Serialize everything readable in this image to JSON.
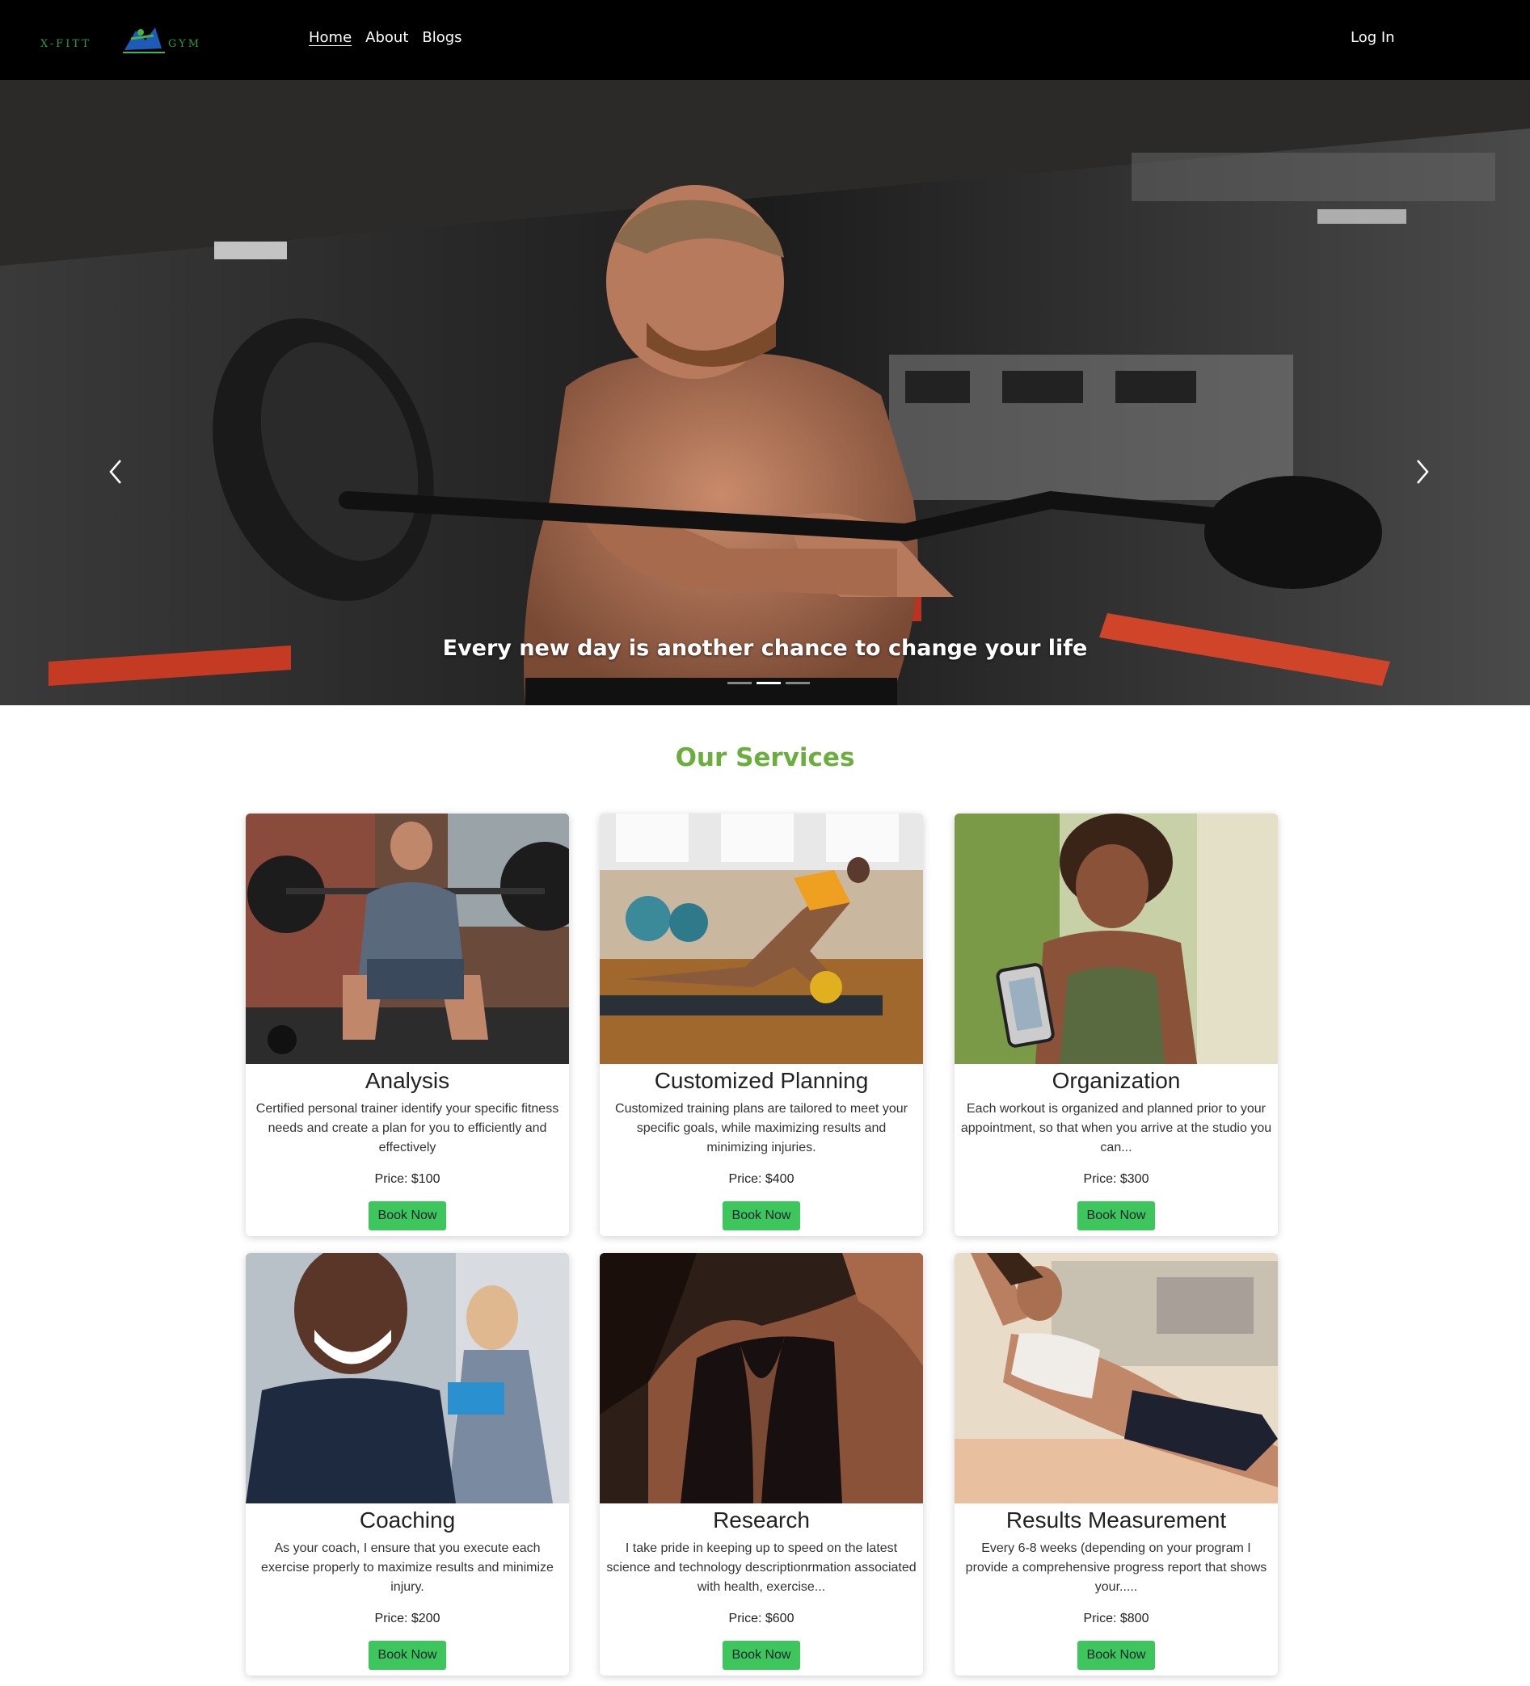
{
  "nav": {
    "logo_text_left": "X-FITT",
    "logo_text_right": "GYM",
    "links": [
      "Home",
      "About",
      "Blogs"
    ],
    "login": "Log In"
  },
  "hero": {
    "caption": "Every new day is another chance to change your life",
    "slides_count": 3,
    "active_slide": 2
  },
  "services": {
    "title": "Our Services",
    "book_label": "Book Now",
    "cards": [
      {
        "title": "Analysis",
        "desc": "Certified personal trainer identify your specific fitness needs and create a plan for you to efficiently and effectively",
        "price": "Price: $100"
      },
      {
        "title": "Customized Planning",
        "desc": "Customized training plans are tailored to meet your specific goals, while maximizing results and minimizing injuries.",
        "price": "Price: $400"
      },
      {
        "title": "Organization",
        "desc": "Each workout is organized and planned prior to your appointment, so that when you arrive at the studio you can...",
        "price": "Price: $300"
      },
      {
        "title": "Coaching",
        "desc": "As your coach, I ensure that you execute each exercise properly to maximize results and minimize injury.",
        "price": "Price: $200"
      },
      {
        "title": "Research",
        "desc": "I take pride in keeping up to speed on the latest science and technology descriptionrmation associated with health, exercise...",
        "price": "Price: $600"
      },
      {
        "title": "Results Measurement",
        "desc": "Every 6-8 weeks (depending on your program I provide a comprehensive progress report that shows your.....",
        "price": "Price: $800"
      }
    ]
  },
  "colors": {
    "nav_bg": "#000000",
    "accent_green": "#6aaf3d",
    "button_green": "#3cc65c"
  }
}
